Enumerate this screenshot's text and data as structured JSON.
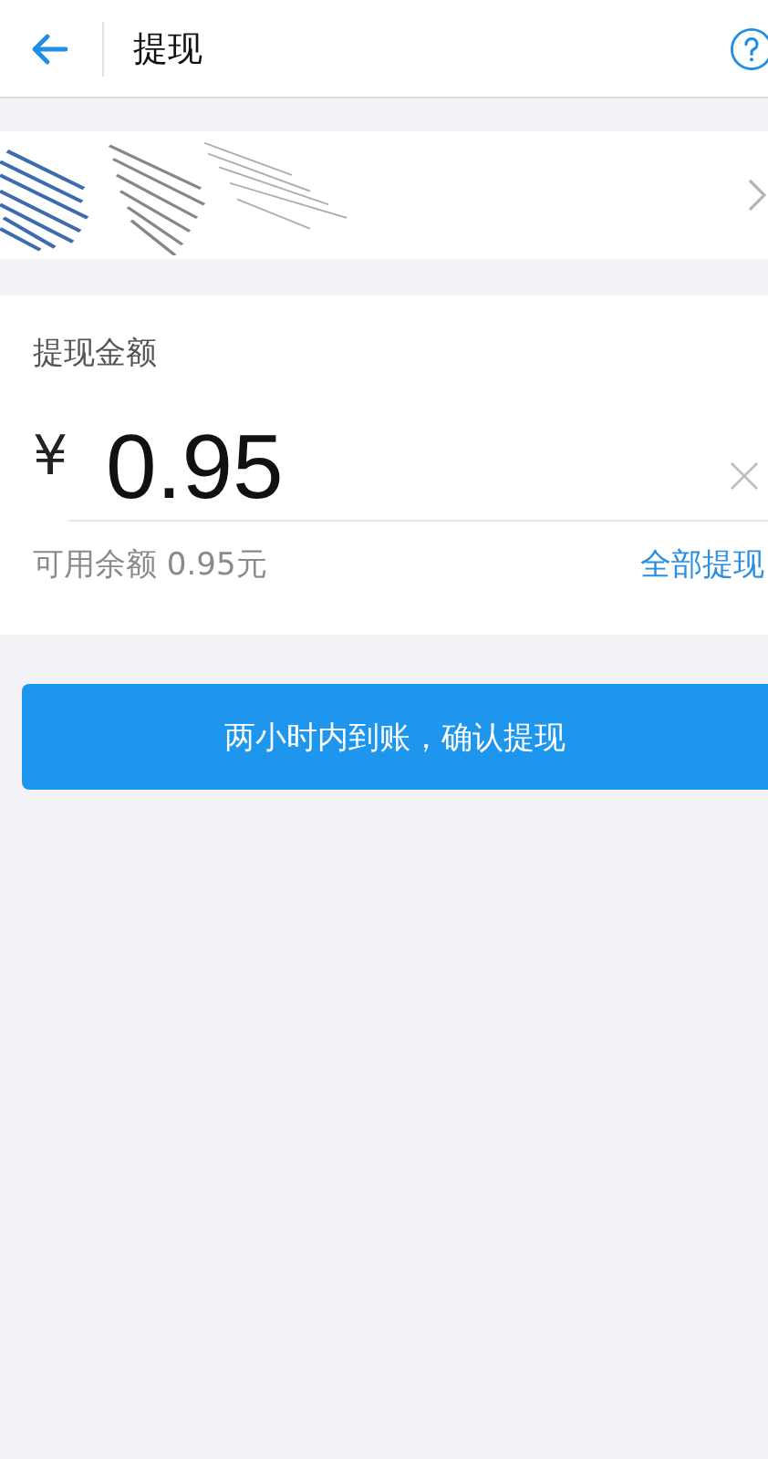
{
  "header": {
    "title": "提现"
  },
  "amount": {
    "label": "提现金额",
    "currency": "¥",
    "value": "0.95",
    "balance": "可用余额 0.95元",
    "withdraw_all": "全部提现"
  },
  "confirm_button": "两小时内到账，确认提现"
}
